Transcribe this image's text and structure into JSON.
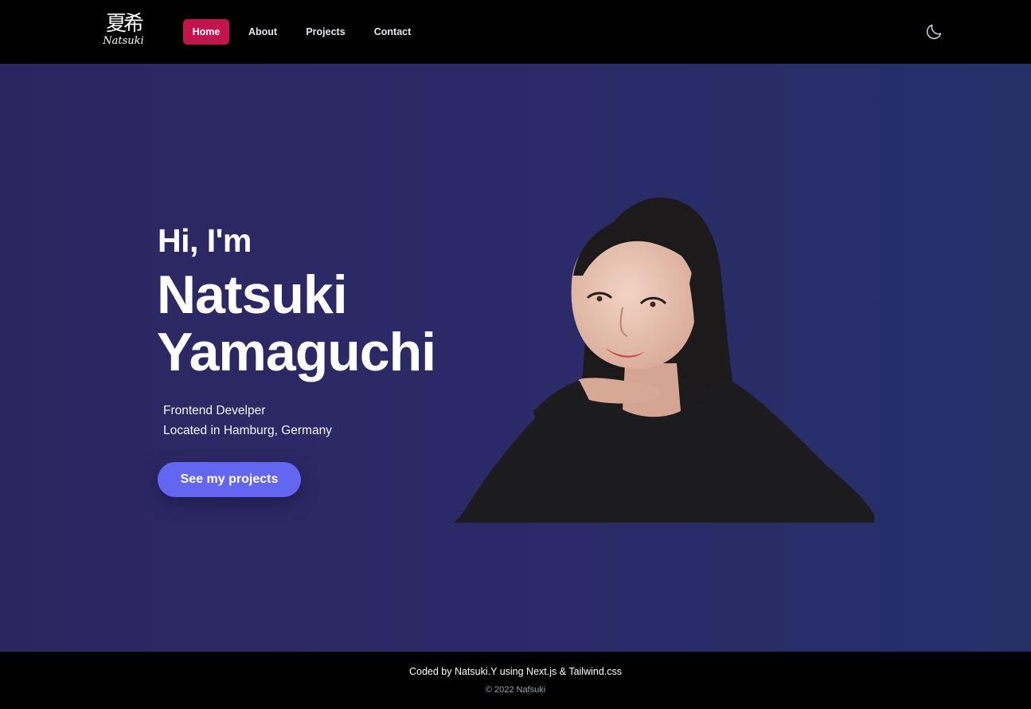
{
  "header": {
    "logo": {
      "kanji": "夏希",
      "script": "Natsuki"
    },
    "nav": [
      {
        "label": "Home",
        "active": true
      },
      {
        "label": "About",
        "active": false
      },
      {
        "label": "Projects",
        "active": false
      },
      {
        "label": "Contact",
        "active": false
      }
    ],
    "theme_toggle_icon": "moon-icon"
  },
  "hero": {
    "greeting": "Hi, I'm",
    "first_name": "Natsuki",
    "last_name": "Yamaguchi",
    "role": "Frontend Develper",
    "location": "Located in Hamburg, Germany",
    "cta_label": "See my projects"
  },
  "footer": {
    "credit": "Coded by Natsuki.Y using Next.js & Tailwind.css",
    "copyright": "© 2022 Nafsuki"
  },
  "colors": {
    "nav_active": "#c4144f",
    "hero_bg": "#2b2a68",
    "cta": "#6366f1"
  }
}
